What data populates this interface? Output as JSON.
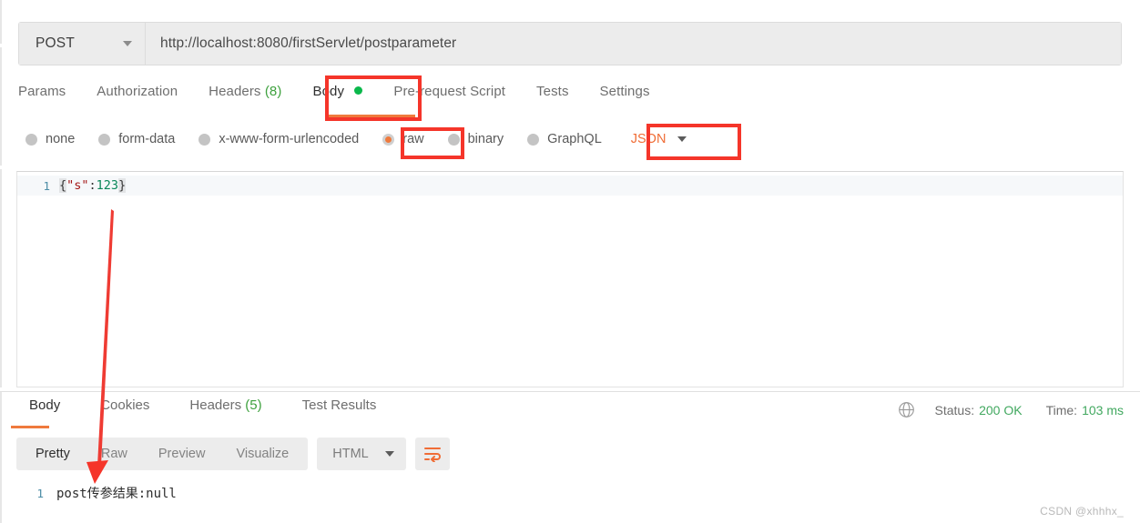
{
  "request": {
    "method": "POST",
    "url": "http://localhost:8080/firstServlet/postparameter",
    "tabs": [
      {
        "label": "Params",
        "active": false
      },
      {
        "label": "Authorization",
        "active": false
      },
      {
        "label": "Headers",
        "count": "(8)",
        "active": false
      },
      {
        "label": "Body",
        "active": true,
        "indicator": "green-dot"
      },
      {
        "label": "Pre-request Script",
        "active": false
      },
      {
        "label": "Tests",
        "active": false
      },
      {
        "label": "Settings",
        "active": false
      }
    ],
    "body_types": [
      {
        "label": "none",
        "selected": false
      },
      {
        "label": "form-data",
        "selected": false
      },
      {
        "label": "x-www-form-urlencoded",
        "selected": false
      },
      {
        "label": "raw",
        "selected": true
      },
      {
        "label": "binary",
        "selected": false
      },
      {
        "label": "GraphQL",
        "selected": false
      }
    ],
    "format": "JSON",
    "editor": {
      "line_number": "1",
      "tokens": {
        "open_brace": "{",
        "key": "\"s\"",
        "colon": ":",
        "number": "123",
        "close_brace": "}"
      }
    }
  },
  "response": {
    "tabs": [
      {
        "label": "Body",
        "active": true
      },
      {
        "label": "Cookies",
        "active": false
      },
      {
        "label": "Headers",
        "count": "(5)",
        "active": false
      },
      {
        "label": "Test Results",
        "active": false
      }
    ],
    "status_label": "Status:",
    "status_value": "200 OK",
    "time_label": "Time:",
    "time_value": "103 ms",
    "view_modes": [
      {
        "label": "Pretty",
        "active": true
      },
      {
        "label": "Raw",
        "active": false
      },
      {
        "label": "Preview",
        "active": false
      },
      {
        "label": "Visualize",
        "active": false
      }
    ],
    "format": "HTML",
    "body": {
      "line_number": "1",
      "text": "post传参结果:null"
    }
  },
  "annotations": {
    "highlight_color": "#f5352a",
    "boxes": [
      "body-tab",
      "raw-option",
      "json-format"
    ],
    "arrow": "points-from-request-body-to-response-body"
  },
  "watermark": "CSDN @xhhhx_"
}
